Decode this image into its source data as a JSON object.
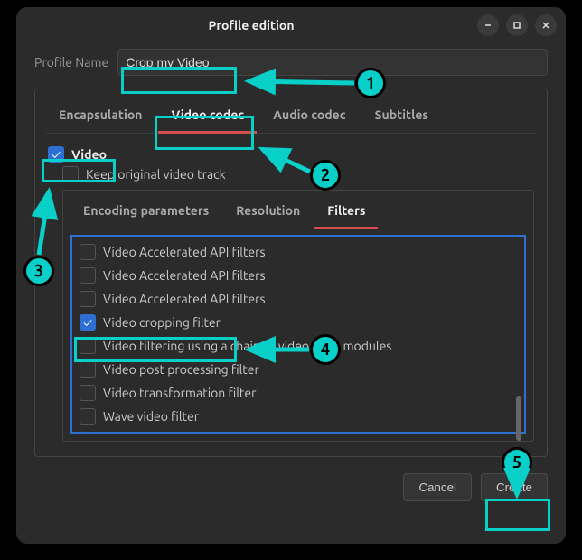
{
  "window": {
    "title": "Profile edition"
  },
  "profileName": {
    "label": "Profile Name",
    "value": "Crop my Video"
  },
  "tabs": {
    "t0": "Encapsulation",
    "t1": "Video codec",
    "t2": "Audio codec",
    "t3": "Subtitles"
  },
  "video": {
    "label": "Video",
    "keepOriginal": "Keep original video track"
  },
  "subtabs": {
    "s0": "Encoding parameters",
    "s1": "Resolution",
    "s2": "Filters"
  },
  "filters": {
    "f0": "Video Accelerated API filters",
    "f1": "Video Accelerated API filters",
    "f2": "Video Accelerated API filters",
    "f3": "Video cropping filter",
    "f4": "Video filtering using a chain of video filter modules",
    "f5": "Video post processing filter",
    "f6": "Video transformation filter",
    "f7": "Wave video filter"
  },
  "buttons": {
    "cancel": "Cancel",
    "create": "Create"
  },
  "annotations": {
    "n1": "1",
    "n2": "2",
    "n3": "3",
    "n4": "4",
    "n5": "5"
  }
}
